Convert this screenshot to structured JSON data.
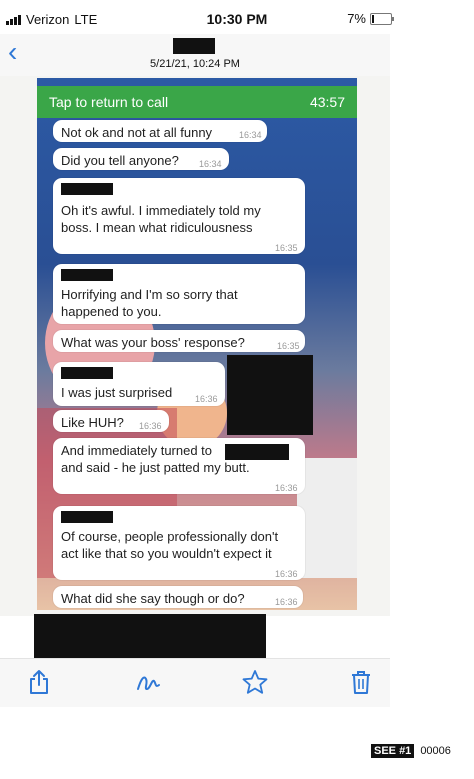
{
  "status_bar": {
    "carrier": "Verizon",
    "network": "LTE",
    "time": "10:30 PM",
    "battery": "7%"
  },
  "photo_header": {
    "date": "5/21/21, 10:24 PM"
  },
  "call_banner": {
    "label": "Tap to return to call",
    "timer": "43:57"
  },
  "messages": [
    {
      "text": "Not ok and not at all funny",
      "time": "16:34"
    },
    {
      "text": "Did you tell anyone?",
      "time": "16:34"
    },
    {
      "text": "Oh it's awful. I immediately told my\nboss. I mean what ridiculousness",
      "time": "16:35"
    },
    {
      "text": "Horrifying and I'm so sorry that\nhappened to you.",
      "time": "16:35"
    },
    {
      "text": "What was your boss' response?",
      "time": "16:35"
    },
    {
      "text": "I was just surprised",
      "time": "16:36"
    },
    {
      "text": "Like HUH?",
      "time": "16:36"
    },
    {
      "text": "And immediately turned to\nand said - he just patted my butt.",
      "time": "16:36"
    },
    {
      "text": "Of course, people professionally don't\nact like that so you wouldn't expect it",
      "time": "16:36"
    },
    {
      "text": "What did she say though or do?",
      "time": "16:36"
    }
  ],
  "toolbar": {
    "icons": [
      "share-icon",
      "markup-icon",
      "favorite-star-icon",
      "trash-icon"
    ],
    "accent": "#2f78d6"
  },
  "footer": {
    "badge": "SEE #1",
    "number": "00006"
  }
}
